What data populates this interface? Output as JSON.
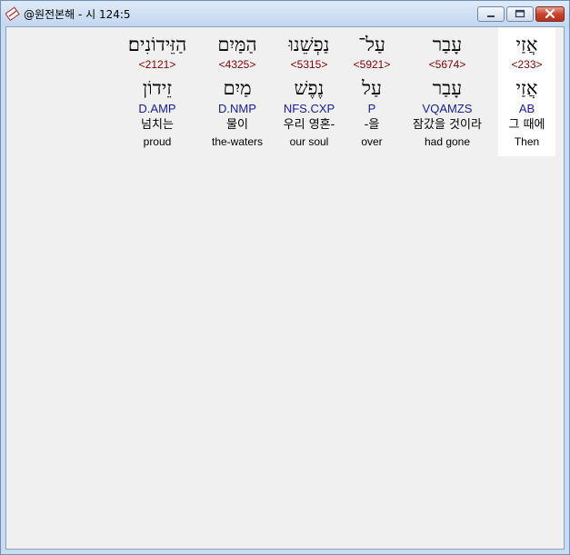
{
  "window": {
    "title": "@원전본해 - 시 124:5",
    "icons": {
      "app": "bible-app-icon",
      "minimize": "minimize-icon",
      "maximize": "maximize-icon",
      "close": "close-icon"
    }
  },
  "words": [
    {
      "hebrew": "אֲזַי",
      "strong": "<233>",
      "lemma": "אֲזַי",
      "morph": "AB",
      "korean": "그 때에",
      "english": "Then",
      "selected": true
    },
    {
      "hebrew": "עָבַר",
      "strong": "<5674>",
      "lemma": "עָבַר",
      "morph": "VQAMZS",
      "korean": "잠갔을 것이라",
      "english": "had gone",
      "selected": false
    },
    {
      "hebrew": "עַל־",
      "strong": "<5921>",
      "lemma": "עַל",
      "morph": "P",
      "korean": "-을",
      "english": "over",
      "selected": false
    },
    {
      "hebrew": "נַפְשֵׁנוּ",
      "strong": "<5315>",
      "lemma": "נֶפֶשׁ",
      "morph": "NFS.CXP",
      "korean": "우리 영혼-",
      "english": "our soul",
      "selected": false
    },
    {
      "hebrew": "הַמַּיִם",
      "strong": "<4325>",
      "lemma": "מַיִם",
      "morph": "D.NMP",
      "korean": "물이",
      "english": "the-waters",
      "selected": false
    },
    {
      "hebrew": "הַזֵּידוֹנִים׃",
      "strong": "<2121>",
      "lemma": "זֵידוֹן",
      "morph": "D.AMP",
      "korean": "넘치는",
      "english": "proud",
      "selected": false
    }
  ]
}
